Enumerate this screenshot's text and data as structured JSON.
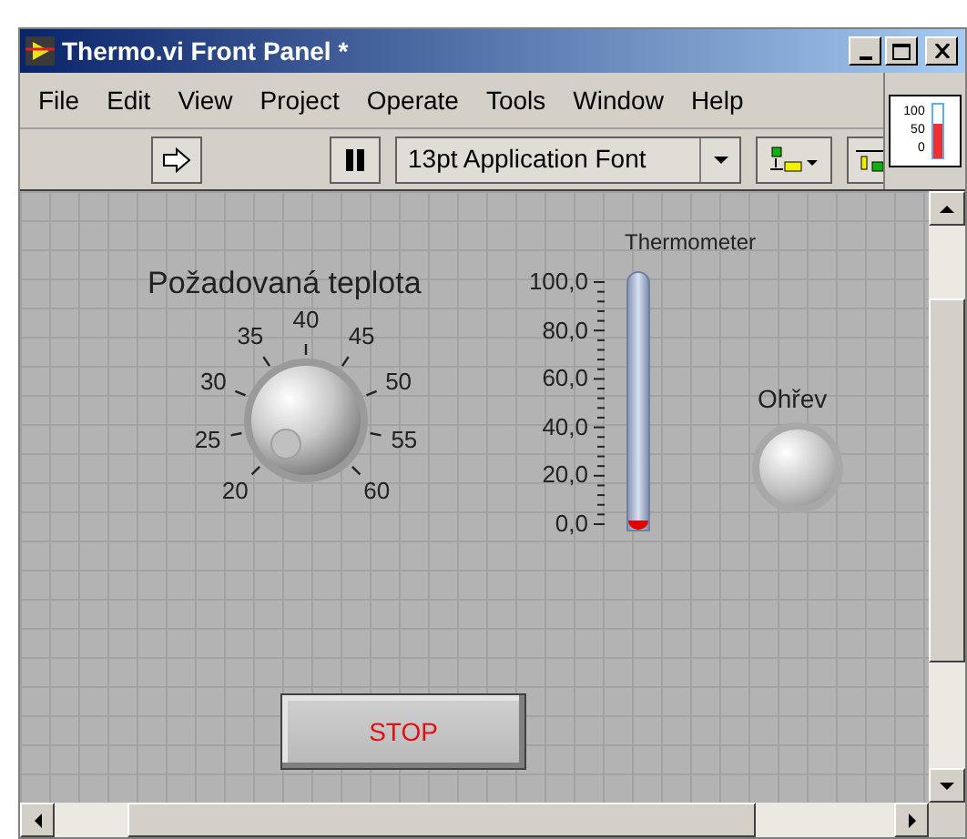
{
  "window": {
    "title": "Thermo.vi Front Panel *"
  },
  "menu": [
    "File",
    "Edit",
    "View",
    "Project",
    "Operate",
    "Tools",
    "Window",
    "Help"
  ],
  "toolbar": {
    "font": "13pt Application Font"
  },
  "vi_icon": {
    "scale": [
      "100",
      "50",
      "0"
    ]
  },
  "knob": {
    "label": "Požadovaná teplota",
    "ticks": [
      "20",
      "25",
      "30",
      "35",
      "40",
      "45",
      "50",
      "55",
      "60"
    ]
  },
  "thermometer": {
    "label": "Thermometer",
    "scale": [
      "100,0",
      "80,0",
      "60,0",
      "40,0",
      "20,0",
      "0,0"
    ],
    "level": 0
  },
  "led": {
    "label": "Ohřev",
    "on": false
  },
  "stop_button": {
    "label": "STOP"
  }
}
